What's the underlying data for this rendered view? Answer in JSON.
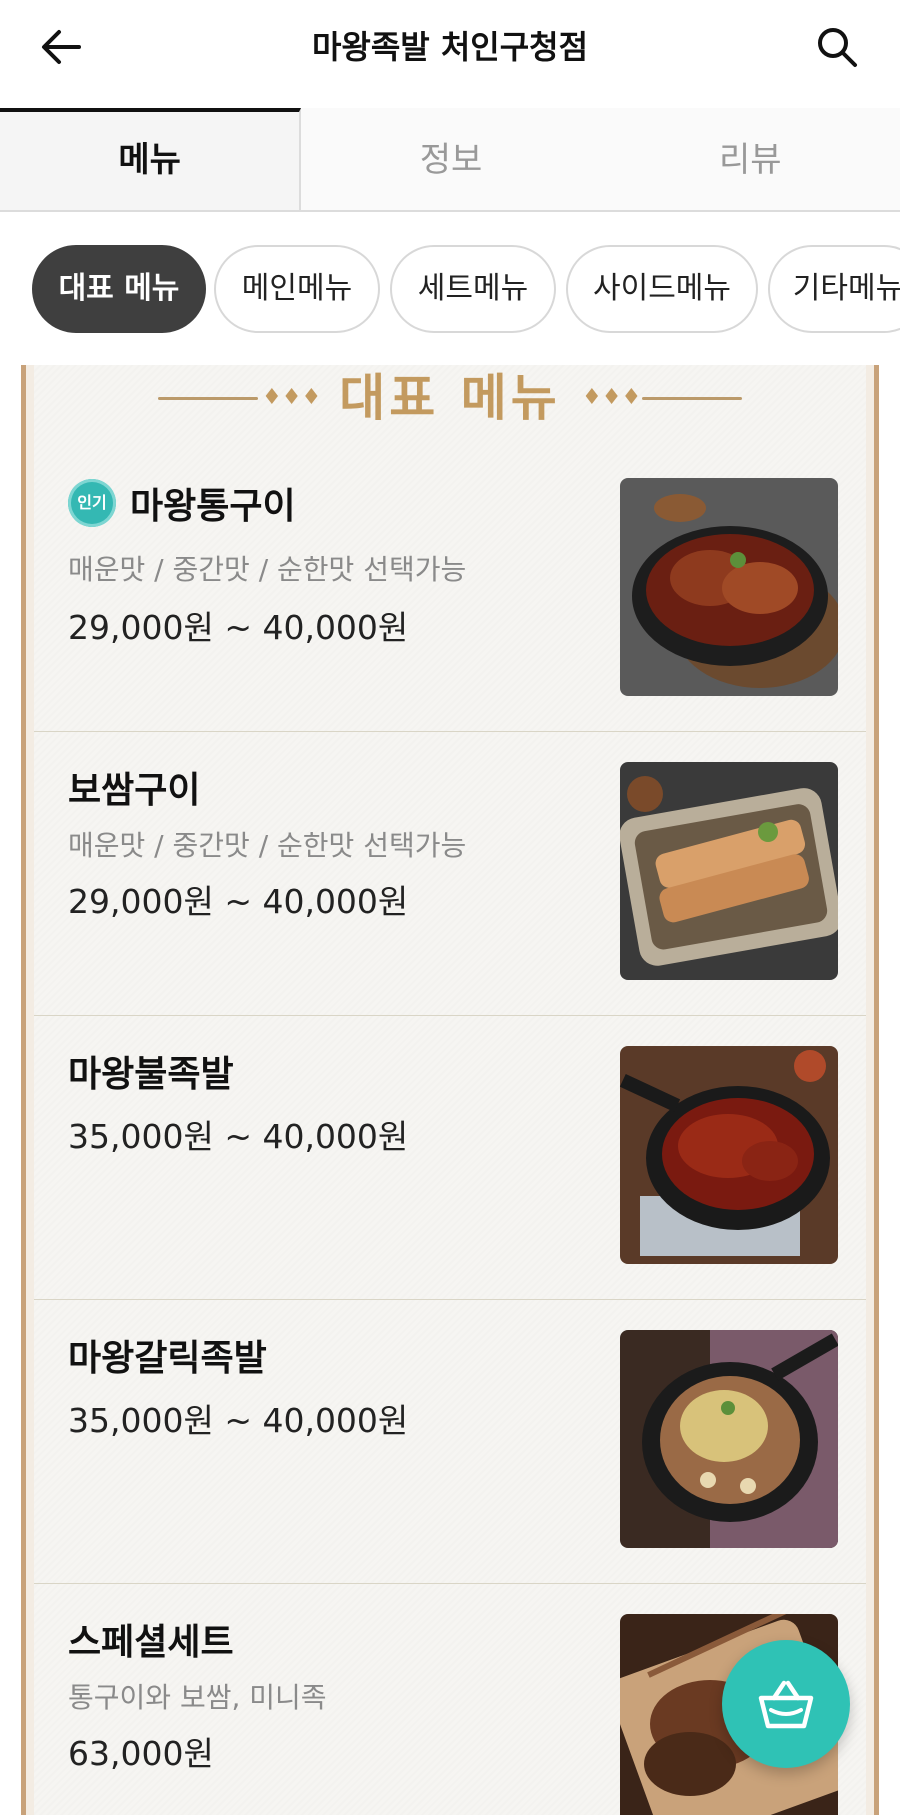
{
  "header": {
    "title": "마왕족발 처인구청점",
    "back_icon": "arrow-left-icon",
    "search_icon": "search-icon"
  },
  "tabs": [
    {
      "label": "메뉴",
      "active": true
    },
    {
      "label": "정보",
      "active": false
    },
    {
      "label": "리뷰",
      "active": false
    }
  ],
  "categories": [
    {
      "label": "대표 메뉴",
      "active": true
    },
    {
      "label": "메인메뉴",
      "active": false
    },
    {
      "label": "세트메뉴",
      "active": false
    },
    {
      "label": "사이드메뉴",
      "active": false
    },
    {
      "label": "기타메뉴",
      "active": false
    }
  ],
  "section": {
    "title": "대표 메뉴"
  },
  "items": [
    {
      "badge": "인기",
      "name": "마왕통구이",
      "description": "매운맛 / 중간맛 / 순한맛 선택가능",
      "price": "29,000원 ~ 40,000원"
    },
    {
      "name": "보쌈구이",
      "description": "매운맛 / 중간맛 / 순한맛 선택가능",
      "price": "29,000원 ~ 40,000원"
    },
    {
      "name": "마왕불족발",
      "price": "35,000원 ~ 40,000원"
    },
    {
      "name": "마왕갈릭족발",
      "price": "35,000원 ~ 40,000원"
    },
    {
      "name": "스페셜세트",
      "description": "통구이와 보쌈, 미니족",
      "price": "63,000원"
    }
  ],
  "fab": {
    "icon": "basket-icon",
    "color": "#2fc2b5"
  },
  "colors": {
    "accent_gold": "#c39a5f",
    "chip_active": "#3f3f3f",
    "badge_teal": "#34b8b3"
  }
}
